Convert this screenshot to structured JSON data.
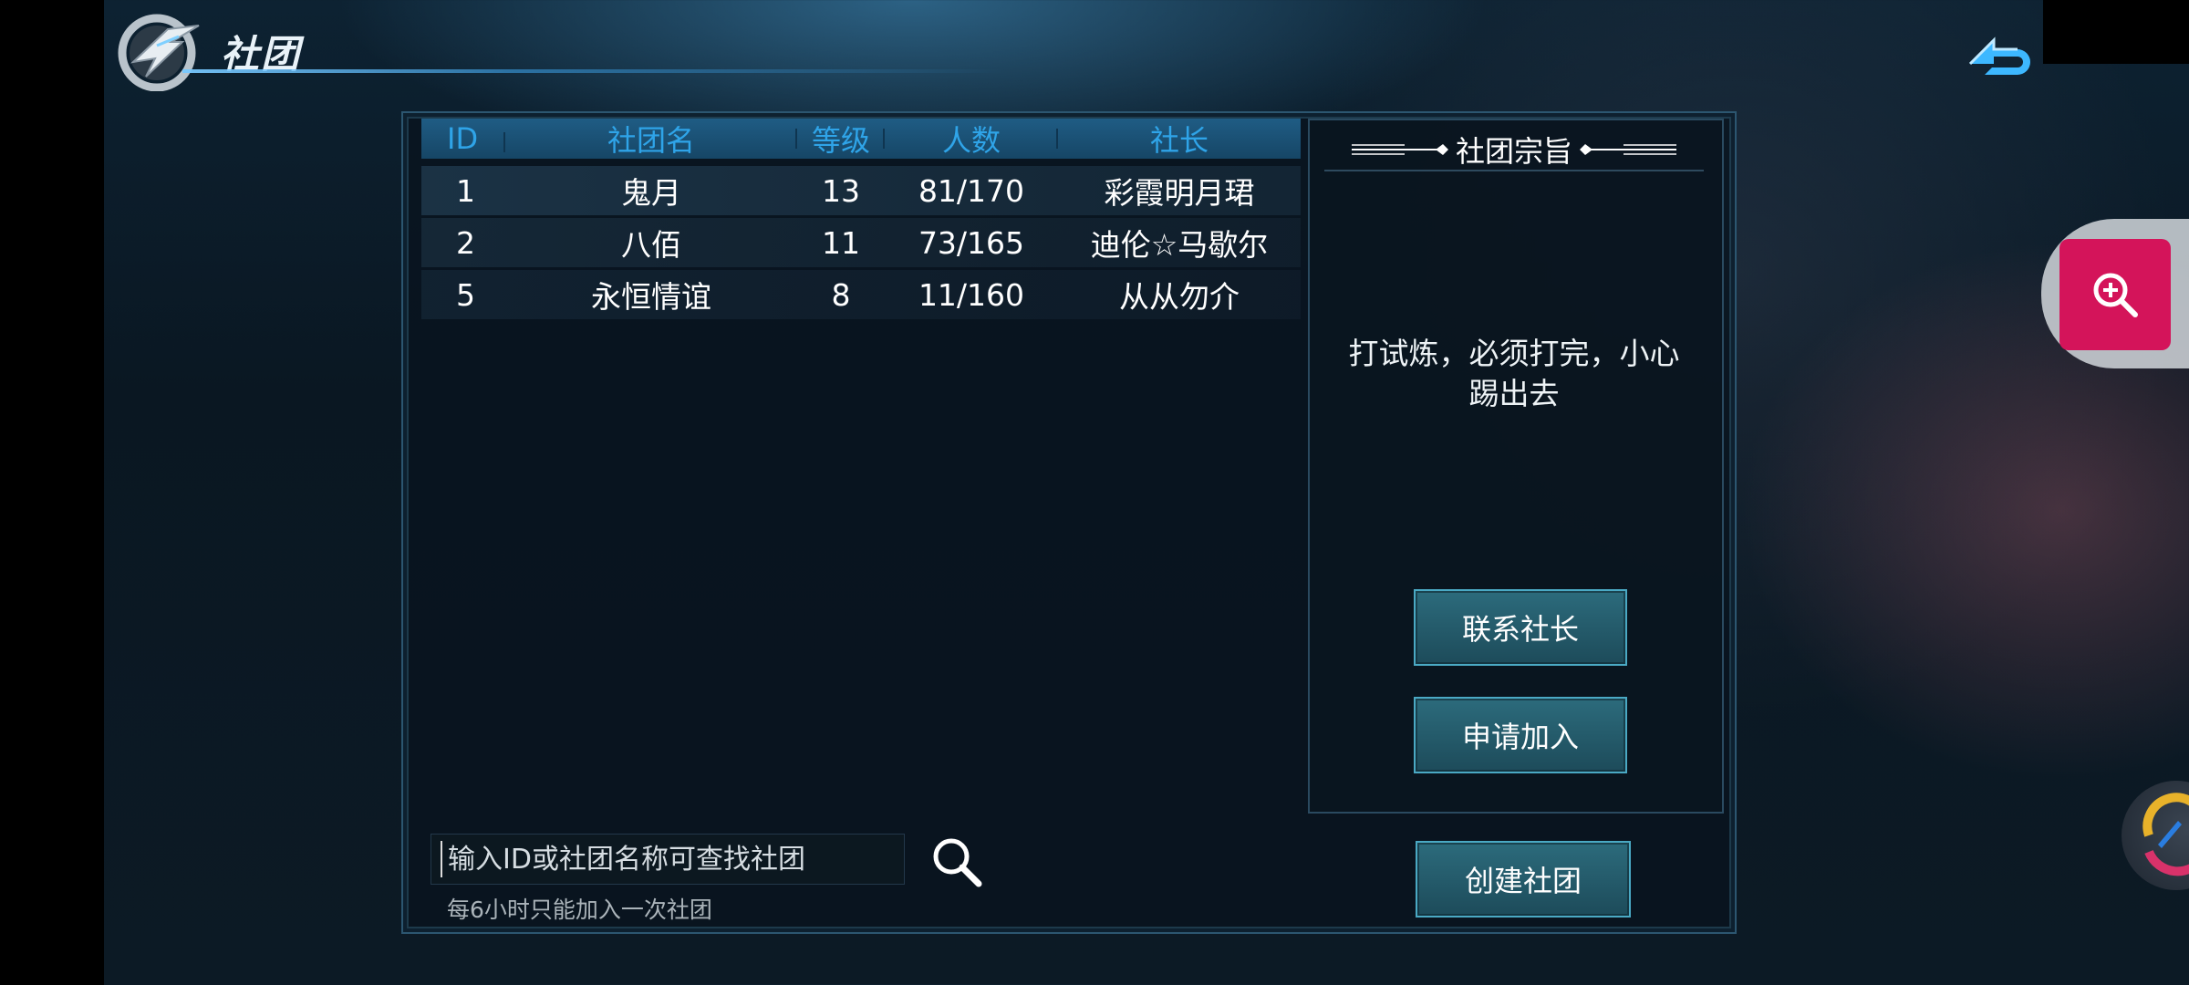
{
  "header": {
    "title": "社团",
    "logo_icon": "game-logo-icon",
    "back_icon": "back-arrow-icon"
  },
  "table": {
    "columns": [
      "ID",
      "社团名",
      "等级",
      "人数",
      "社长"
    ],
    "rows": [
      {
        "id": "1",
        "name": "鬼月",
        "level": "13",
        "members": "81/170",
        "leader": "彩霞明月珺"
      },
      {
        "id": "2",
        "name": "八佰",
        "level": "11",
        "members": "73/165",
        "leader": "迪伦☆马歇尔"
      },
      {
        "id": "5",
        "name": "永恒情谊",
        "level": "8",
        "members": "11/160",
        "leader": "从从勿介"
      }
    ]
  },
  "side_panel": {
    "title": "社团宗旨",
    "purpose_lines": [
      "打试炼，必须打完，小心",
      "踢出去"
    ],
    "contact_button": "联系社长",
    "apply_button": "申请加入",
    "create_button": "创建社团"
  },
  "search": {
    "placeholder": "输入ID或社团名称可查找社团",
    "hint": "每6小时只能加入一次社团",
    "icon": "search-icon"
  },
  "overlay": {
    "zoom_icon": "zoom-in-icon",
    "colors": {
      "zoom_bg": "#d4145a",
      "accent": "#2fa4e8",
      "button_border": "#4aa9c4"
    }
  }
}
